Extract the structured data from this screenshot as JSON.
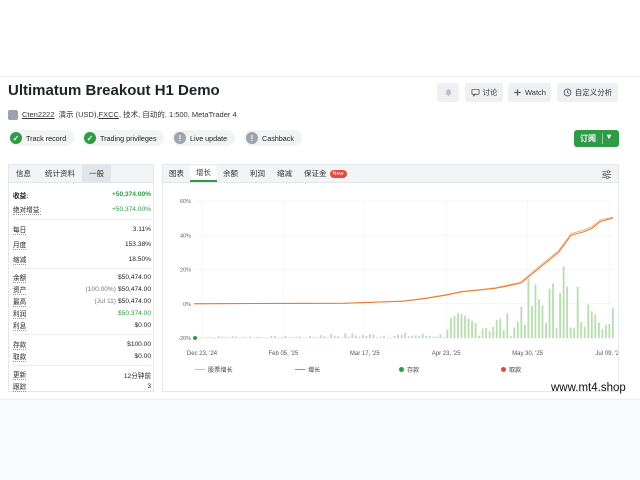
{
  "header": {
    "title": "Ultimatum Breakout H1 Demo",
    "buttons": {
      "discuss": "讨论",
      "watch": "Watch",
      "custom_analysis": "自定义分析",
      "subscribe": "订阅"
    }
  },
  "meta": {
    "author": "Cten2222",
    "details_pre": "演示 (USD),",
    "broker": "FXCC",
    "details_post": ", 技术, 自动的, 1:500, MetaTrader 4"
  },
  "badges": [
    {
      "label": "Track record",
      "status": "ok"
    },
    {
      "label": "Trading privileges",
      "status": "ok"
    },
    {
      "label": "Live update",
      "status": "info"
    },
    {
      "label": "Cashback",
      "status": "info"
    }
  ],
  "left_tabs": [
    "信息",
    "统计资料",
    "一般"
  ],
  "stats": {
    "gain": {
      "label": "收益:",
      "value": "+50,374.00%"
    },
    "abs_gain": {
      "label": "绝对增益:",
      "value": "+50,374.00%"
    },
    "daily": {
      "label": "每日",
      "value": "3.11%"
    },
    "monthly": {
      "label": "月度",
      "value": "153.38%"
    },
    "drawdown": {
      "label": "缩减",
      "value": "18.50%"
    },
    "balance": {
      "label": "余额",
      "value": "$50,474.00"
    },
    "equity": {
      "label": "资产",
      "note": "(100.00%)",
      "value": "$50,474.00"
    },
    "highest": {
      "label": "最高",
      "note": "(Jul 11)",
      "value": "$50,474.00"
    },
    "profit": {
      "label": "利润",
      "value": "$50,374.00"
    },
    "interest": {
      "label": "利息",
      "value": "$0.00"
    },
    "deposits": {
      "label": "存款",
      "value": "$100.00"
    },
    "withdrawals": {
      "label": "取款",
      "value": "$0.00"
    },
    "updated": {
      "label": "更新",
      "value": "12分钟前"
    },
    "tracking": {
      "label": "跟踪",
      "value": "3"
    }
  },
  "right_tabs": [
    "图表",
    "增长",
    "余额",
    "利润",
    "缩减",
    "保证金"
  ],
  "new_badge": "New",
  "legend": [
    "股票增长",
    "增长",
    "存款",
    "取款"
  ],
  "chart_data": {
    "type": "line",
    "x_ticks": [
      "Dec 23, '24",
      "Feb 05, '25",
      "Mar 17, '25",
      "Apr 23, '25",
      "May 30, '25",
      "Jul 09, '25"
    ],
    "y_ticks": [
      "60%",
      "40%",
      "20%",
      "0%",
      "-20%"
    ],
    "series": [
      {
        "name": "增长",
        "color": "#e8792f",
        "points": [
          [
            0,
            0
          ],
          [
            0.36,
            0.3
          ],
          [
            0.42,
            0.8
          ],
          [
            0.46,
            1.2
          ],
          [
            0.5,
            1.5
          ],
          [
            0.55,
            3
          ],
          [
            0.6,
            5
          ],
          [
            0.64,
            7
          ],
          [
            0.68,
            8
          ],
          [
            0.72,
            9
          ],
          [
            0.74,
            10
          ],
          [
            0.78,
            12
          ],
          [
            0.81,
            18
          ],
          [
            0.84,
            24
          ],
          [
            0.87,
            30
          ],
          [
            0.9,
            40
          ],
          [
            0.93,
            42
          ],
          [
            0.95,
            44
          ],
          [
            0.97,
            48
          ],
          [
            1.0,
            50
          ]
        ]
      },
      {
        "name": "股票增长",
        "color": "#f4b183",
        "points": [
          [
            0,
            0
          ],
          [
            0.36,
            0.3
          ],
          [
            0.42,
            0.8
          ],
          [
            0.46,
            1.2
          ],
          [
            0.5,
            1.6
          ],
          [
            0.55,
            3.2
          ],
          [
            0.6,
            5.2
          ],
          [
            0.64,
            7.2
          ],
          [
            0.68,
            8.2
          ],
          [
            0.72,
            9.4
          ],
          [
            0.74,
            10.4
          ],
          [
            0.78,
            12.6
          ],
          [
            0.81,
            19
          ],
          [
            0.84,
            25
          ],
          [
            0.87,
            31
          ],
          [
            0.9,
            41
          ],
          [
            0.93,
            43
          ],
          [
            0.95,
            45
          ],
          [
            0.97,
            49
          ],
          [
            1.0,
            50.5
          ]
        ]
      }
    ],
    "bar_color": "#b8ddb0",
    "deposit_color": "#2f9b46",
    "withdrawal_color": "#e8453c"
  }
}
